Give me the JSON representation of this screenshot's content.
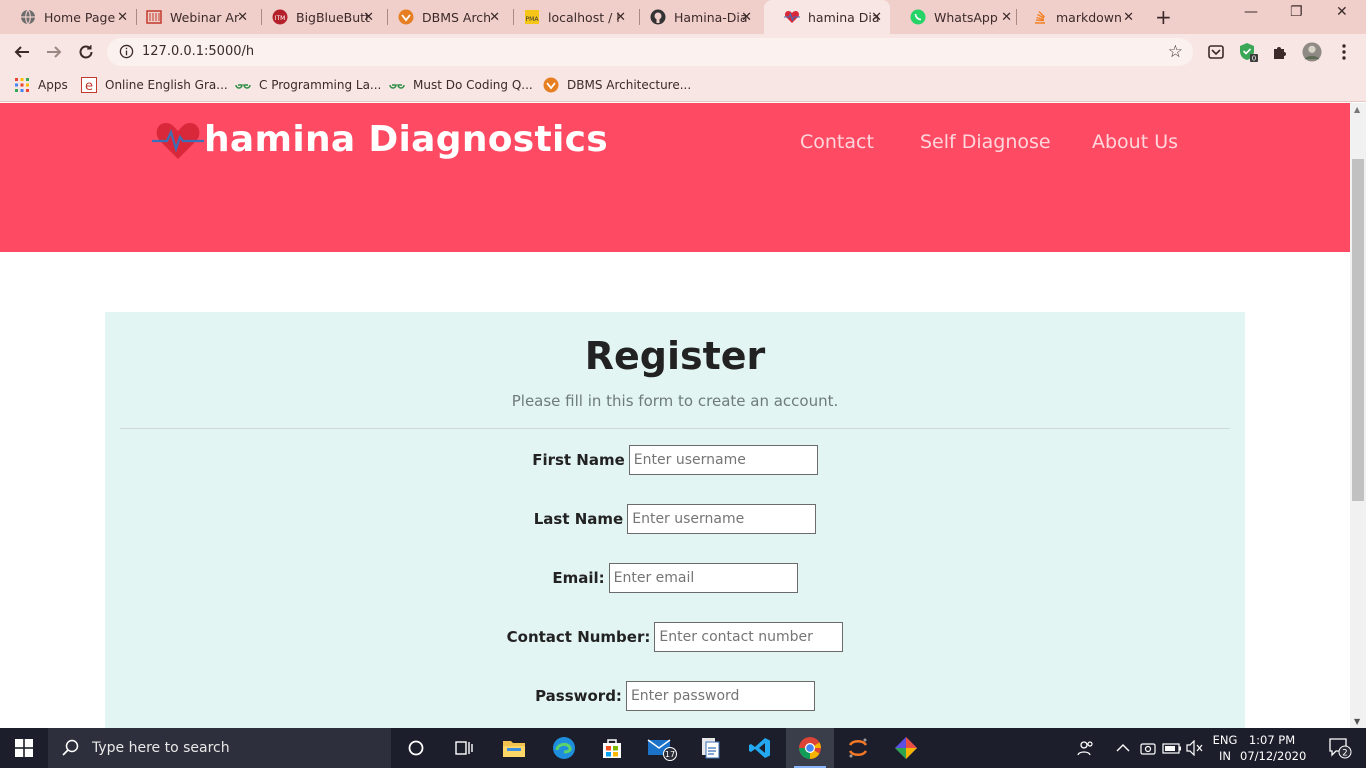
{
  "browser": {
    "tabs": [
      {
        "title": "Home Page",
        "icon": "globe-icon"
      },
      {
        "title": "Webinar Ar",
        "icon": "webinar-icon"
      },
      {
        "title": "BigBlueButt",
        "icon": "bigbluebutton-icon"
      },
      {
        "title": "DBMS Arch",
        "icon": "dbms-icon"
      },
      {
        "title": "localhost / l",
        "icon": "phpmyadmin-icon"
      },
      {
        "title": "Hamina-Dia",
        "icon": "github-icon"
      },
      {
        "title": "hamina Dia",
        "icon": "heart-icon"
      },
      {
        "title": "WhatsApp",
        "icon": "whatsapp-icon"
      },
      {
        "title": "markdown",
        "icon": "stackoverflow-icon"
      }
    ],
    "url": "127.0.0.1:5000/h",
    "bookmarks": [
      {
        "label": "Apps",
        "icon": "apps-grid-icon"
      },
      {
        "label": "Online English Gra...",
        "icon": "english-icon"
      },
      {
        "label": "C Programming La...",
        "icon": "gfg-icon"
      },
      {
        "label": "Must Do Coding Q...",
        "icon": "gfg-icon"
      },
      {
        "label": "DBMS Architecture...",
        "icon": "dbms-icon"
      }
    ],
    "extension_badge": "0"
  },
  "site": {
    "brand": "hamina Diagnostics",
    "nav": {
      "contact": "Contact",
      "self_diagnose": "Self Diagnose",
      "about": "About Us"
    },
    "colors": {
      "header": "#ff4a63",
      "card": "#e2f5f3"
    }
  },
  "form": {
    "title": "Register",
    "subtitle": "Please fill in this form to create an account.",
    "fields": [
      {
        "label": "First Name",
        "placeholder": "Enter username"
      },
      {
        "label": "Last Name",
        "placeholder": "Enter username"
      },
      {
        "label": "Email:",
        "placeholder": "Enter email"
      },
      {
        "label": "Contact Number:",
        "placeholder": "Enter contact number"
      },
      {
        "label": "Password:",
        "placeholder": "Enter password"
      }
    ]
  },
  "taskbar": {
    "search_placeholder": "Type here to search",
    "mail_badge": "17",
    "language": {
      "line1": "ENG",
      "line2": "IN"
    },
    "time": "1:07 PM",
    "date": "07/12/2020",
    "notification_count": "2"
  }
}
